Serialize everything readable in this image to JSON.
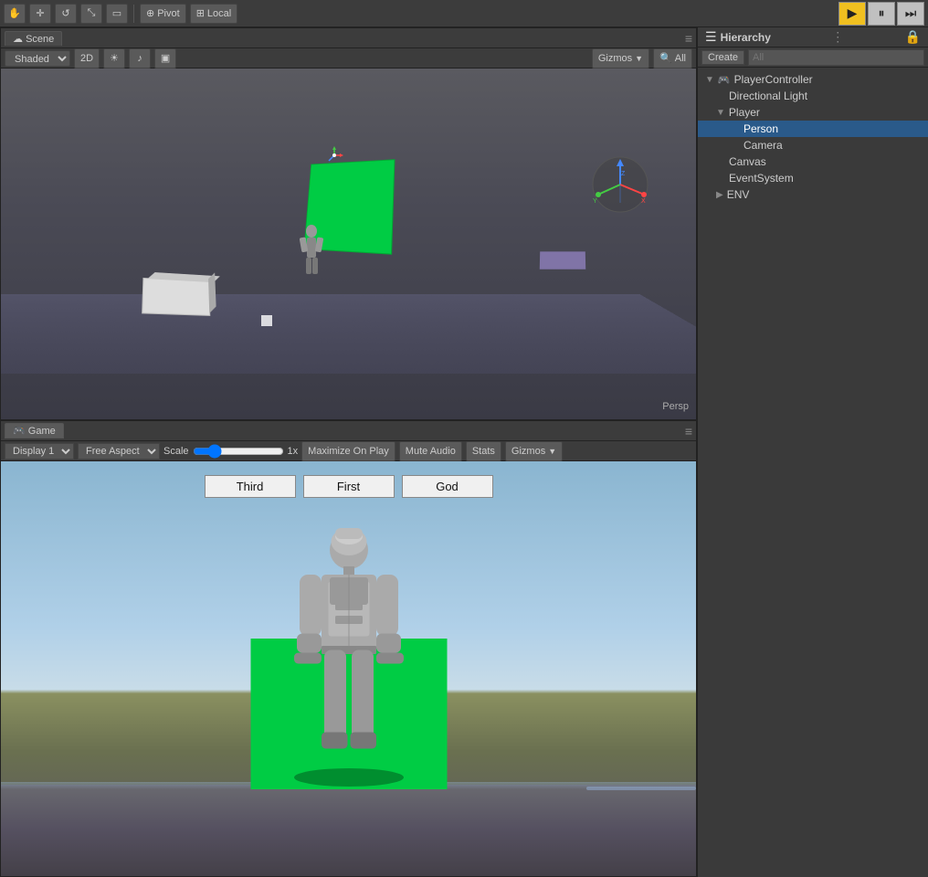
{
  "toolbar": {
    "tools": [
      {
        "id": "hand",
        "icon": "✋",
        "label": "Hand Tool"
      },
      {
        "id": "move",
        "icon": "✛",
        "label": "Move Tool"
      },
      {
        "id": "rotate",
        "icon": "↺",
        "label": "Rotate Tool"
      },
      {
        "id": "scale",
        "icon": "⤡",
        "label": "Scale Tool"
      },
      {
        "id": "rect",
        "icon": "▭",
        "label": "Rect Tool"
      }
    ],
    "pivot_label": "Pivot",
    "local_label": "Local",
    "play_tooltip": "Play",
    "pause_tooltip": "Pause",
    "step_tooltip": "Step"
  },
  "scene": {
    "tab_label": "Scene",
    "shading_label": "Shaded",
    "mode_2d": "2D",
    "gizmos_label": "Gizmos",
    "all_label": "All",
    "persp_label": "Persp"
  },
  "game": {
    "tab_label": "Game",
    "display_label": "Display 1",
    "aspect_label": "Free Aspect",
    "scale_label": "Scale",
    "scale_value": "1x",
    "maximize_label": "Maximize On Play",
    "mute_label": "Mute Audio",
    "stats_label": "Stats",
    "gizmos_label": "Gizmos",
    "camera_buttons": [
      {
        "id": "third",
        "label": "Third"
      },
      {
        "id": "first",
        "label": "First"
      },
      {
        "id": "god",
        "label": "God"
      }
    ]
  },
  "hierarchy": {
    "title": "Hierarchy",
    "create_label": "Create",
    "search_placeholder": "All",
    "items": [
      {
        "id": "player-controller",
        "label": "PlayerController",
        "indent": 0,
        "has_arrow": true,
        "arrow_open": true,
        "icon": "🎮"
      },
      {
        "id": "directional-light",
        "label": "Directional Light",
        "indent": 1,
        "has_arrow": false,
        "icon": "💡"
      },
      {
        "id": "player",
        "label": "Player",
        "indent": 1,
        "has_arrow": true,
        "arrow_open": true,
        "icon": ""
      },
      {
        "id": "person",
        "label": "Person",
        "indent": 2,
        "has_arrow": false,
        "icon": "",
        "selected": true
      },
      {
        "id": "camera",
        "label": "Camera",
        "indent": 2,
        "has_arrow": false,
        "icon": ""
      },
      {
        "id": "canvas",
        "label": "Canvas",
        "indent": 1,
        "has_arrow": false,
        "icon": ""
      },
      {
        "id": "event-system",
        "label": "EventSystem",
        "indent": 1,
        "has_arrow": false,
        "icon": ""
      },
      {
        "id": "env",
        "label": "ENV",
        "indent": 1,
        "has_arrow": true,
        "arrow_open": false,
        "icon": ""
      }
    ]
  }
}
